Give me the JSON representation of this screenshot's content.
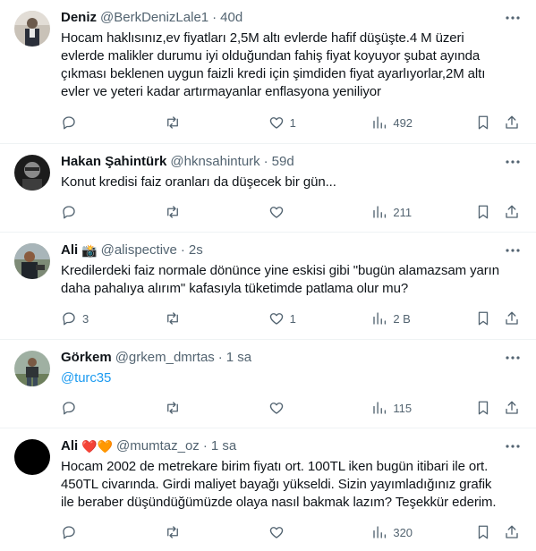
{
  "tweets": [
    {
      "name": "Deniz",
      "handle": "@BerkDenizLale1",
      "dot": "·",
      "time": "40d",
      "text": "Hocam haklısınız,ev fiyatları 2,5M altı evlerde hafif düşüşte.4 M üzeri evlerde malikler durumu iyi olduğundan  fahiş fiyat koyuyor şubat ayında çıkması beklenen uygun faizli kredi için şimdiden fiyat ayarlıyorlar,2M altı evler ve yeteri kadar artırmayanlar enflasyona yeniliyor",
      "replies": "",
      "retweets": "",
      "likes": "1",
      "views": "492"
    },
    {
      "name": "Hakan Şahintürk",
      "handle": "@hknsahinturk",
      "dot": "·",
      "time": "59d",
      "text": "Konut kredisi faiz oranları da  düşecek bir gün...",
      "replies": "",
      "retweets": "",
      "likes": "",
      "views": "211"
    },
    {
      "name": "Ali",
      "name_emoji": "📸",
      "handle": "@alispective",
      "dot": "·",
      "time": "2s",
      "text": "Kredilerdeki faiz normale dönünce yine eskisi gibi \"bugün alamazsam yarın daha pahalıya alırım\" kafasıyla tüketimde patlama olur mu?",
      "replies": "3",
      "retweets": "",
      "likes": "1",
      "views": "2 B"
    },
    {
      "name": "Görkem",
      "handle": "@grkem_dmrtas",
      "dot": "·",
      "time": "1 sa",
      "link": "@turc35",
      "replies": "",
      "retweets": "",
      "likes": "",
      "views": "115"
    },
    {
      "name": "Ali",
      "name_emoji": "❤️🧡",
      "handle": "@mumtaz_oz",
      "dot": "·",
      "time": "1 sa",
      "text": "Hocam 2002 de metrekare birim fiyatı ort. 100TL iken bugün itibari ile ort. 450TL civarında. Girdi maliyet bayağı yükseldi. Sizin yayımladığınız grafik ile beraber düşündüğümüzde olaya nasıl bakmak lazım? Teşekkür ederim.",
      "replies": "",
      "retweets": "",
      "likes": "",
      "views": "320"
    }
  ],
  "icons": {
    "more": "more-dots-icon",
    "reply": "reply-icon",
    "retweet": "retweet-icon",
    "like": "heart-icon",
    "views": "views-bar-chart-icon",
    "bookmark": "bookmark-icon",
    "share": "share-icon"
  },
  "colors": {
    "text": "#0f1419",
    "muted": "#536471",
    "link": "#1d9bf0",
    "divider": "#eff3f4"
  }
}
